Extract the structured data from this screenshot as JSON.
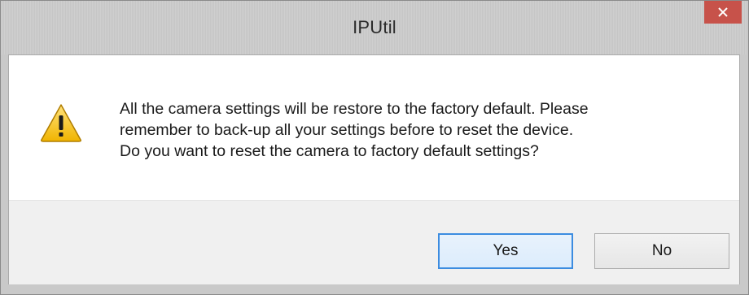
{
  "window": {
    "title": "IPUtil"
  },
  "dialog": {
    "icon": "warning-icon",
    "message_lines": [
      "All the camera settings will be restore to the factory default. Please",
      "remember to back-up all your settings before to reset the device.",
      "Do you want to reset the camera to factory default settings?"
    ]
  },
  "buttons": {
    "yes_label": "Yes",
    "no_label": "No"
  },
  "colors": {
    "close_button": "#c7524a",
    "default_button_border": "#3c8ce0",
    "warning_yellow": "#f4c430"
  }
}
